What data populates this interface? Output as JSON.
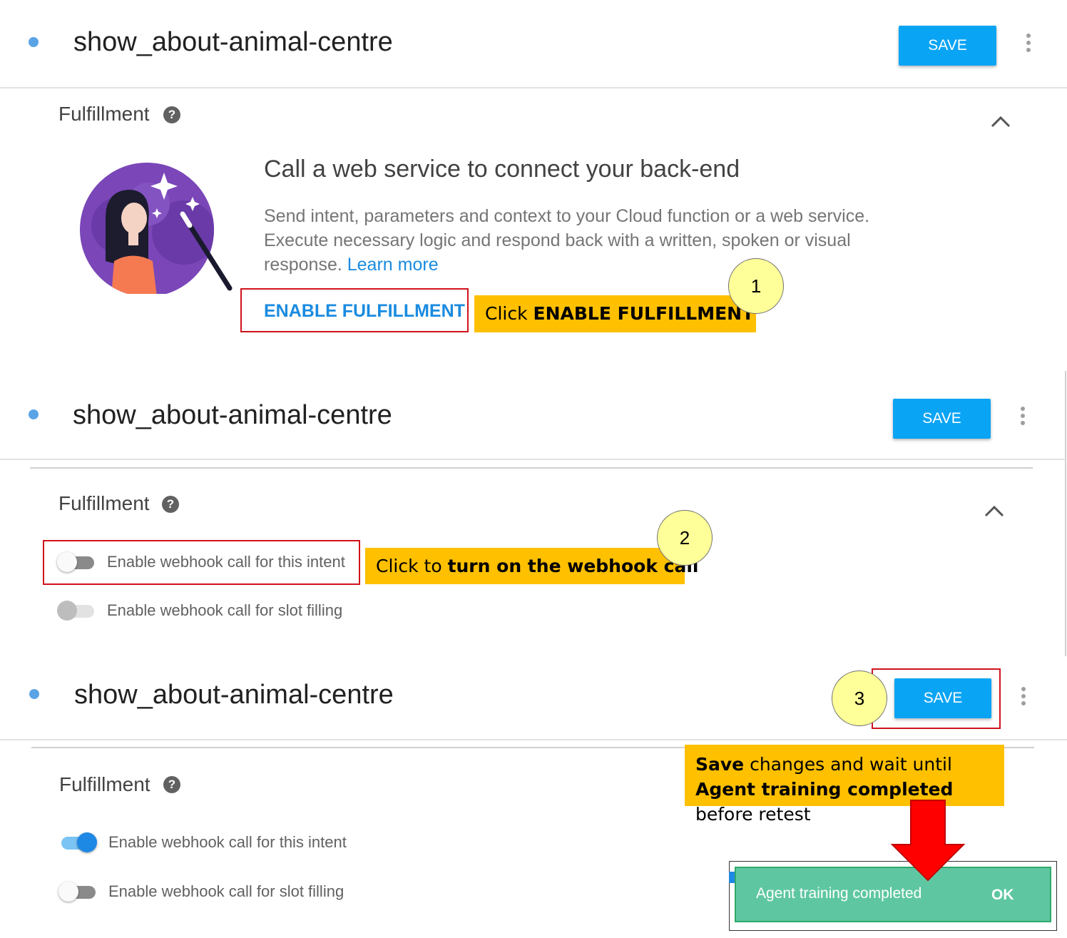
{
  "panel1": {
    "intent_title": "show_about-animal-centre",
    "save_label": "SAVE",
    "section_label": "Fulfillment",
    "help_glyph": "?",
    "heading": "Call a web service to connect your back-end",
    "description": "Send intent, parameters and context to your Cloud function or a web service. Execute necessary logic and respond back with a written, spoken or visual response.",
    "learn_more": "Learn more",
    "enable_button": "ENABLE FULFILLMENT"
  },
  "panel2": {
    "intent_title": "show_about-animal-centre",
    "save_label": "SAVE",
    "section_label": "Fulfillment",
    "help_glyph": "?",
    "toggles": [
      {
        "label": "Enable webhook call for this intent",
        "on": false
      },
      {
        "label": "Enable webhook call for slot filling",
        "on": false
      }
    ]
  },
  "panel3": {
    "intent_title": "show_about-animal-centre",
    "save_label": "SAVE",
    "section_label": "Fulfillment",
    "help_glyph": "?",
    "toggles": [
      {
        "label": "Enable webhook call for this intent",
        "on": true
      },
      {
        "label": "Enable webhook call for slot filling",
        "on": false
      }
    ]
  },
  "annotations": {
    "step1": {
      "number": "1",
      "prefix": "Click ",
      "bold": "ENABLE FULFILLMENT"
    },
    "step2": {
      "number": "2",
      "prefix": "Click to ",
      "bold": "turn on the webhook call"
    },
    "step3": {
      "number": "3"
    },
    "note": {
      "bold1": "Save",
      "text1": " changes and wait until ",
      "bold2": "Agent training completed",
      "text2": " before retest"
    }
  },
  "toast": {
    "message": "Agent training completed",
    "action": "OK"
  },
  "colors": {
    "accent": "#0aa4f5",
    "toggle_on": "#1e88e5",
    "callout": "#ffc000",
    "highlight_box": "#d0121b",
    "toast_bg": "#5ec7a2",
    "arrow": "#ff0000"
  },
  "icons": [
    "dot-icon",
    "help-icon",
    "chevron-up-icon",
    "more-vert-icon",
    "wand-illustration",
    "down-arrow-icon"
  ]
}
